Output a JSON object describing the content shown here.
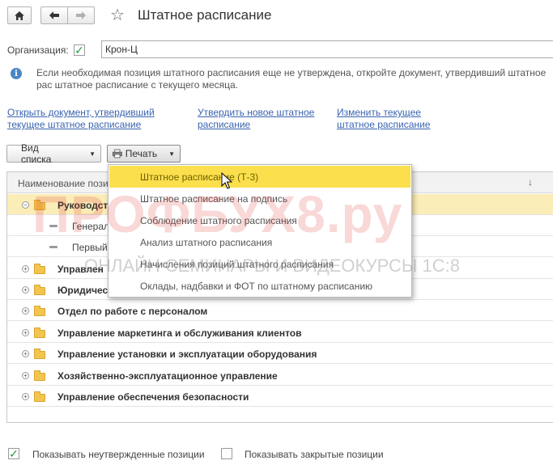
{
  "window": {
    "title": "Штатное расписание"
  },
  "toolbar": {
    "home_icon": "home-icon",
    "back_icon": "arrow-left-icon",
    "forward_icon": "arrow-right-icon",
    "favorite_icon": "star-icon"
  },
  "organization": {
    "label": "Организация:",
    "value": "Крон-Ц",
    "checked": true
  },
  "info": {
    "text": "Если необходимая позиция штатного расписания еще не утверждена, откройте документ, утвердивший штатное рас штатное расписание с текущего месяца."
  },
  "links": {
    "open_doc_line1": "Открыть документ, утвердивший",
    "open_doc_line2": "текущее штатное расписание",
    "approve_new_line1": "Утвердить новое штатное",
    "approve_new_line2": "расписание",
    "change_current_line1": "Изменить текущее",
    "change_current_line2": "штатное расписание"
  },
  "buttons": {
    "view_list": "Вид списка",
    "print": "Печать"
  },
  "table": {
    "header": "Наименование пози",
    "rows": [
      {
        "label": "Руководств",
        "kind": "folder-open"
      },
      {
        "label": "Генерал",
        "kind": "item"
      },
      {
        "label": "Первый",
        "kind": "item"
      },
      {
        "label": "Управлен",
        "kind": "folder"
      },
      {
        "label": "Юридичес",
        "kind": "folder"
      },
      {
        "label": "Отдел по работе с персоналом",
        "kind": "folder"
      },
      {
        "label": "Управление маркетинга и обслуживания клиентов",
        "kind": "folder"
      },
      {
        "label": "Управление установки и эксплуатации оборудования",
        "kind": "folder"
      },
      {
        "label": "Хозяйственно-эксплуатационное управление",
        "kind": "folder"
      },
      {
        "label": "Управление обеспечения безопасности",
        "kind": "folder"
      }
    ]
  },
  "print_menu": {
    "items": [
      "Штатное расписание (Т-3)",
      "Штатное расписание на подпись",
      "Соблюдение штатного расписания",
      "Анализ штатного расписания",
      "Начисления позиций штатного расписания",
      "Оклады, надбавки и ФОТ по штатному расписанию"
    ]
  },
  "watermark": {
    "main": "ПРОФБУХ8.ру",
    "sub": "ОНЛАЙН СЕМИНАРЫ И ВИДЕОКУРСЫ 1С:8"
  },
  "footer": {
    "show_unapproved": "Показывать неутвержденные позиции",
    "show_unapproved_checked": true,
    "show_closed": "Показывать закрытые позиции",
    "show_closed_checked": false
  },
  "colors": {
    "link": "#3a64b0",
    "menu_highlight": "#fcdf4c",
    "selected_row": "#fbedb7",
    "check_green": "#1e9e3a",
    "watermark_red": "#dc2828"
  }
}
